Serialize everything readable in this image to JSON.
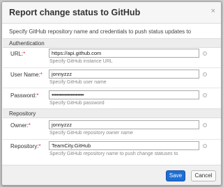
{
  "dialog": {
    "title": "Report change status to GitHub",
    "close_glyph": "×",
    "intro": "Specify GitHub repository name and credentials to push status updates to",
    "sections": {
      "auth": "Authentication",
      "repo": "Repository"
    },
    "required_mark": "*",
    "fields": {
      "url": {
        "label": "URL:",
        "value": "https://api.github.com",
        "hint": "Specify GitHub instance URL"
      },
      "user": {
        "label": "User Name:",
        "value": "jonnyzzz",
        "hint": "Specify GitHub user name"
      },
      "password": {
        "label": "Password:",
        "value": "••••••••••••••••••••",
        "hint": "Specify GitHub password"
      },
      "owner": {
        "label": "Owner:",
        "value": "jonnyzzz",
        "hint": "Specify GitHub repository owner name"
      },
      "repository": {
        "label": "Repository:",
        "value": "TeamCity.GitHub",
        "hint": "Specify GitHub repository name to push change statuses to"
      }
    },
    "buttons": {
      "save": "Save",
      "cancel": "Cancel"
    },
    "help_icon": "help-circle-icon",
    "colors": {
      "primary_button": "#1f6ed4",
      "required": "#e03030"
    }
  }
}
